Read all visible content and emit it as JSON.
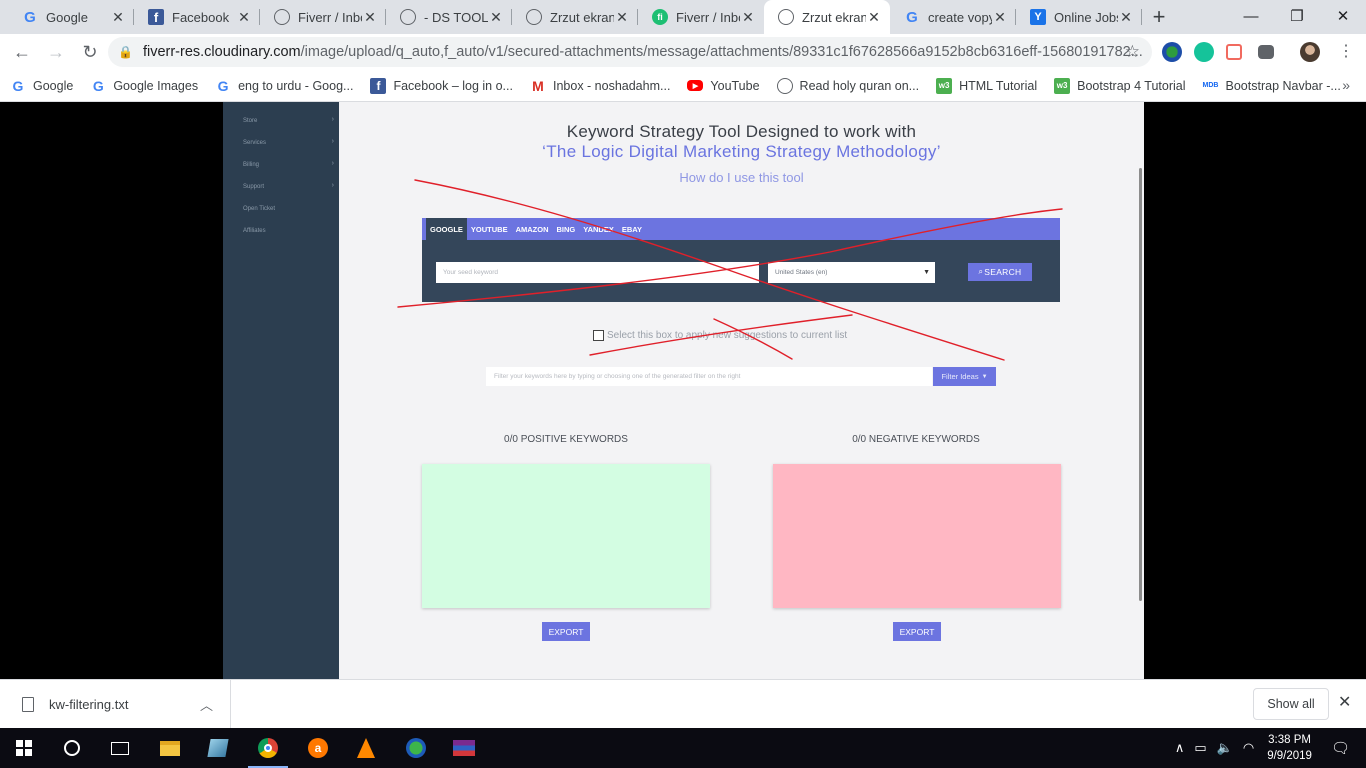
{
  "tabs": [
    {
      "title": "Google",
      "icon": "google-icon"
    },
    {
      "title": "Facebook",
      "icon": "facebook-icon"
    },
    {
      "title": "Fiverr / Inbox",
      "icon": "globe-icon"
    },
    {
      "title": "- DS TOOL",
      "icon": "globe-icon"
    },
    {
      "title": "Zrzut ekranu",
      "icon": "globe-icon"
    },
    {
      "title": "Fiverr / Inbox",
      "icon": "fiverr-icon"
    },
    {
      "title": "Zrzut ekranu",
      "icon": "globe-icon",
      "active": true
    },
    {
      "title": "create vopy",
      "icon": "google-icon"
    },
    {
      "title": "Online Jobs",
      "icon": "yahoo-icon"
    }
  ],
  "address": {
    "host": "fiverr-res.cloudinary.com",
    "path": "/image/upload/q_auto,f_auto/v1/secured-attachments/message/attachments/89331c1f67628566a9152b8cb6316eff-15680191782..."
  },
  "bookmarks": [
    {
      "label": "Google",
      "icon": "google-icon"
    },
    {
      "label": "Google Images",
      "icon": "google-icon"
    },
    {
      "label": "eng to urdu - Goog...",
      "icon": "google-icon"
    },
    {
      "label": "Facebook – log in o...",
      "icon": "facebook-icon"
    },
    {
      "label": "Inbox - noshadahm...",
      "icon": "gmail-icon"
    },
    {
      "label": "YouTube",
      "icon": "youtube-icon"
    },
    {
      "label": "Read holy quran on...",
      "icon": "globe-icon"
    },
    {
      "label": "HTML Tutorial",
      "icon": "w3schools-icon"
    },
    {
      "label": "Bootstrap 4 Tutorial",
      "icon": "w3schools-icon"
    },
    {
      "label": "Bootstrap Navbar -...",
      "icon": "mdb-icon"
    }
  ],
  "sidebar": {
    "items": [
      {
        "label": "Store"
      },
      {
        "label": "Services"
      },
      {
        "label": "Billing"
      },
      {
        "label": "Support"
      },
      {
        "label": "Open Ticket"
      },
      {
        "label": "Affiliates"
      }
    ]
  },
  "page": {
    "title_line1": "Keyword Strategy Tool Designed to work with",
    "title_line2": "‘The Logic Digital Marketing Strategy Methodology’",
    "howto_link": "How do I use this tool",
    "engine_tabs": [
      "GOOGLE",
      "YOUTUBE",
      "AMAZON",
      "BING",
      "YANDEX",
      "EBAY"
    ],
    "active_engine": "GOOGLE",
    "seed_placeholder": "Your seed keyword",
    "country_value": "United States (en)",
    "search_button": "SEARCH",
    "append_checkbox_label": "Select this box to apply new suggestions to current list",
    "filter_placeholder": "Filter your keywords here by typing or choosing one of the generated filter on the right",
    "filter_button": "Filter Ideas",
    "positive_heading": "0/0 POSITIVE KEYWORDS",
    "negative_heading": "0/0 NEGATIVE KEYWORDS",
    "export_label": "EXPORT",
    "colors": {
      "accent": "#6c74e0",
      "positive": "#d3fde2",
      "negative": "#ffb7c3",
      "scribble": "#e0202a"
    }
  },
  "downloads": {
    "file": "kw-filtering.txt",
    "show_all": "Show all"
  },
  "taskbar": {
    "time": "3:38 PM",
    "date": "9/9/2019"
  }
}
